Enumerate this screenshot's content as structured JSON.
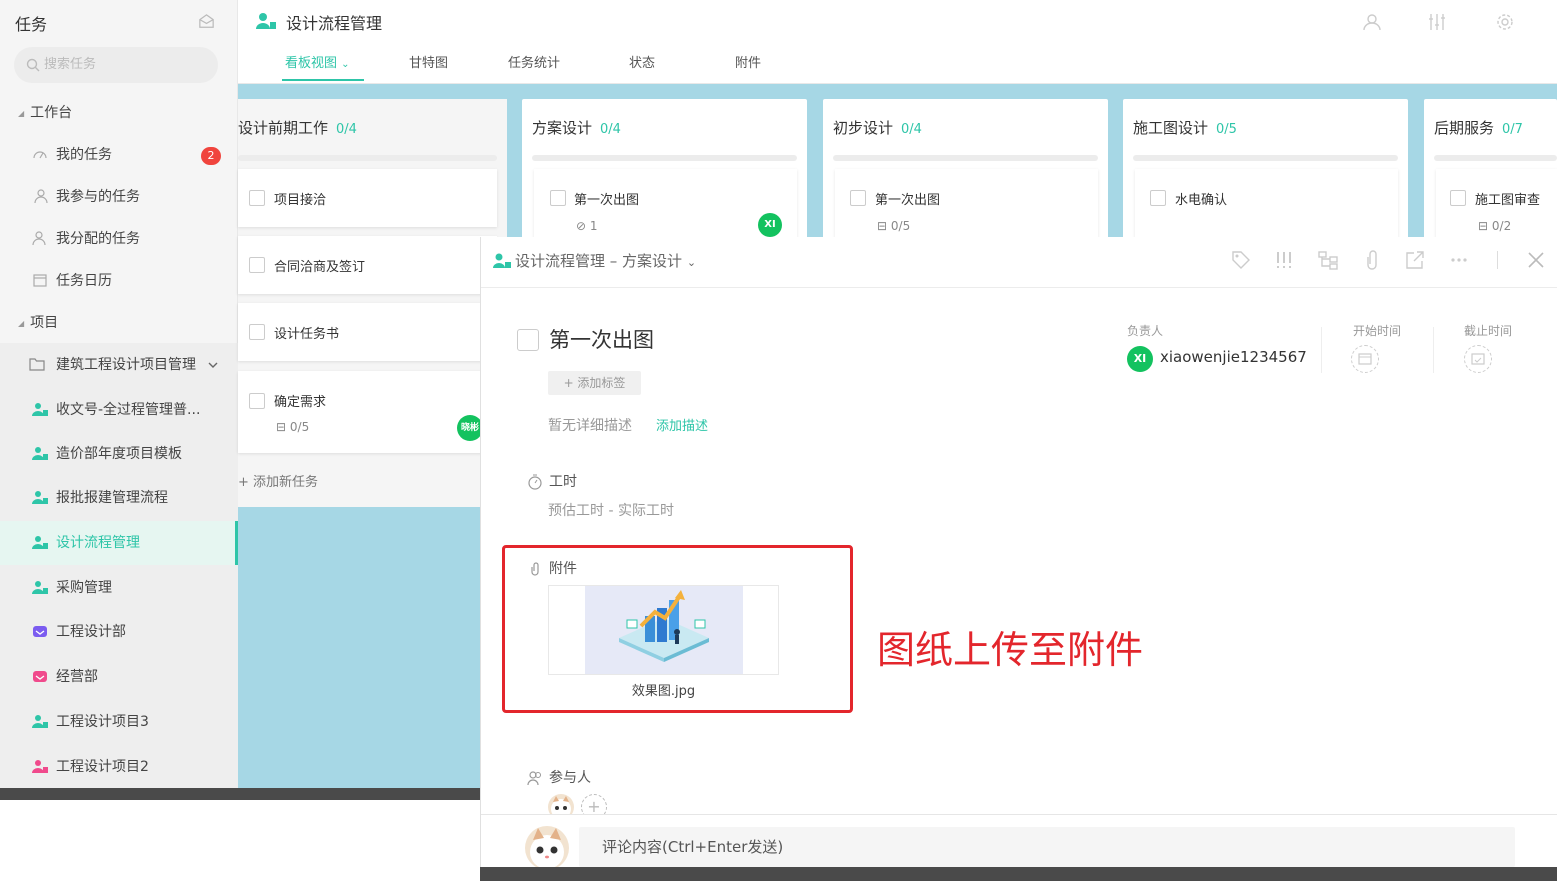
{
  "sidebar": {
    "title": "任务",
    "search_placeholder": "搜索任务",
    "sections": {
      "workbench": "工作台",
      "projects": "项目"
    },
    "my_items": [
      {
        "label": "我的任务",
        "badge": "2"
      },
      {
        "label": "我参与的任务"
      },
      {
        "label": "我分配的任务"
      },
      {
        "label": "任务日历"
      }
    ],
    "group": {
      "label": "建筑工程设计项目管理"
    },
    "projects": [
      {
        "label": "收文号-全过程管理普...",
        "color": "#2ec5a8"
      },
      {
        "label": "造价部年度项目模板",
        "color": "#2ec5a8"
      },
      {
        "label": "报批报建管理流程",
        "color": "#2ec5a8"
      },
      {
        "label": "设计流程管理",
        "color": "#2ec5a8",
        "active": true
      },
      {
        "label": "采购管理",
        "color": "#2ec5a8"
      },
      {
        "label": "工程设计部",
        "color": "#7b5cf0"
      },
      {
        "label": "经营部",
        "color": "#f04a8c"
      },
      {
        "label": "工程设计项目3",
        "color": "#2ec5a8"
      },
      {
        "label": "工程设计项目2",
        "color": "#f04a8c"
      }
    ]
  },
  "header": {
    "project_title": "设计流程管理",
    "tabs": [
      "看板视图",
      "甘特图",
      "任务统计",
      "状态",
      "附件"
    ]
  },
  "board": {
    "columns": [
      {
        "name": "设计前期工作",
        "count": "0/4",
        "cards": [
          {
            "title": "项目接洽"
          },
          {
            "title": "合同洽商及签订"
          },
          {
            "title": "设计任务书"
          },
          {
            "title": "确定需求",
            "sub": "0/5",
            "avatar": "晓彬"
          }
        ],
        "add_task": "添加新任务"
      },
      {
        "name": "方案设计",
        "count": "0/4",
        "cards": [
          {
            "title": "第一次出图",
            "sub": "1",
            "avatar": "XI"
          }
        ]
      },
      {
        "name": "初步设计",
        "count": "0/4",
        "cards": [
          {
            "title": "第一次出图",
            "sub": "0/5"
          }
        ]
      },
      {
        "name": "施工图设计",
        "count": "0/5",
        "cards": [
          {
            "title": "水电确认"
          }
        ]
      },
      {
        "name": "后期服务",
        "count": "0/7",
        "cards": [
          {
            "title": "施工图审查",
            "sub": "0/2"
          }
        ]
      }
    ]
  },
  "detail": {
    "breadcrumb": "设计流程管理 – 方案设计",
    "task_title": "第一次出图",
    "add_tag": "+ 添加标签",
    "no_desc": "暂无详细描述",
    "add_desc": "添加描述",
    "owner_label": "负责人",
    "owner_initials": "XI",
    "owner_name": "xiaowenjie1234567",
    "start_label": "开始时间",
    "due_label": "截止时间",
    "hours_label": "工时",
    "hours_value": "预估工时 - 实际工时",
    "attach_label": "附件",
    "file_name": "效果图.jpg",
    "participants_label": "参与人",
    "comment_placeholder": "评论内容(Ctrl+Enter发送)"
  },
  "annotation": "图纸上传至附件"
}
